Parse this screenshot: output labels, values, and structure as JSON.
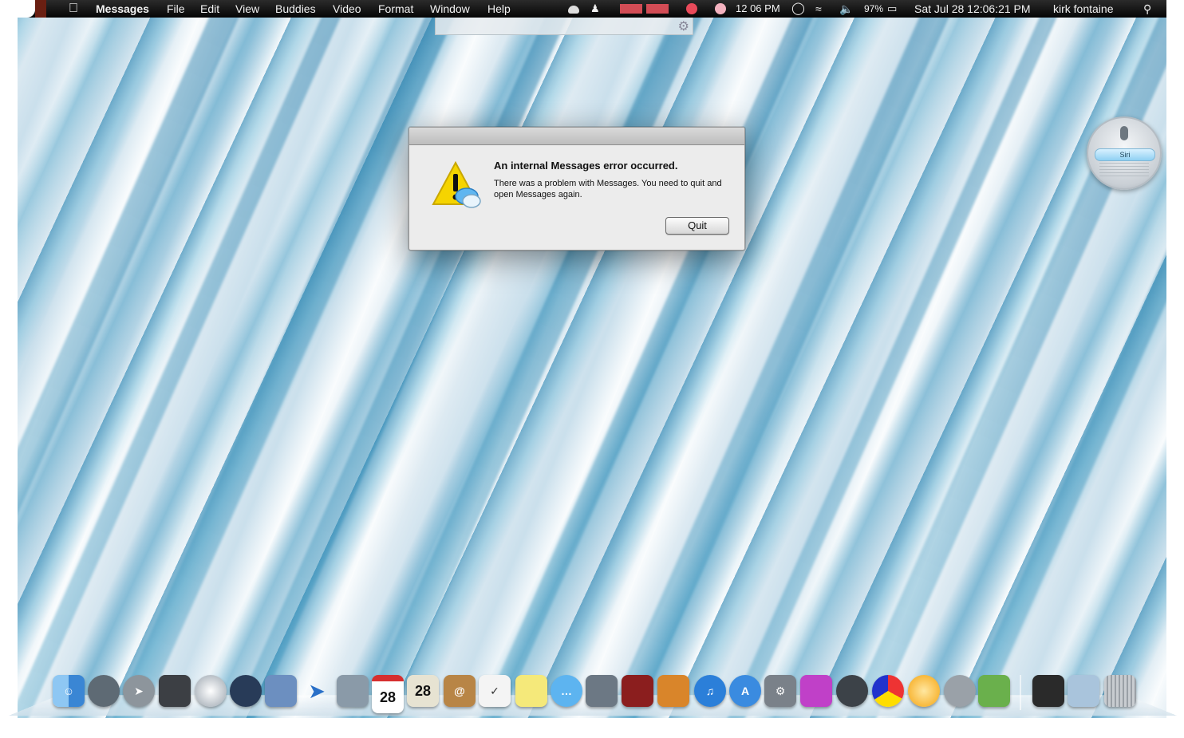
{
  "menubar": {
    "app_name": "Messages",
    "menus": [
      "File",
      "Edit",
      "View",
      "Buddies",
      "Video",
      "Format",
      "Window",
      "Help"
    ],
    "status_time": "12 06 PM",
    "battery": "97%",
    "clock": "Sat Jul 28  12:06:21 PM",
    "user": "kirk fontaine"
  },
  "dialog": {
    "headline": "An internal Messages error occurred.",
    "message": "There was a problem with Messages. You need to quit and open Messages again.",
    "quit_label": "Quit"
  },
  "siri": {
    "label": "Siri"
  },
  "dock": {
    "apps": [
      "finder",
      "launchpad-app",
      "rocket",
      "photo-app",
      "safari",
      "migration",
      "preview",
      "mail-send",
      "mail",
      "calendar",
      "ical",
      "contacts",
      "reminders",
      "notes",
      "messages",
      "facetime",
      "photo-booth",
      "iphoto",
      "itunes",
      "app-store",
      "system-preferences",
      "keynote",
      "time-machine",
      "colors",
      "orange-ball",
      "growl",
      "evernote",
      "folder-dark",
      "folder",
      "trash"
    ],
    "calendar_day": "28"
  },
  "colors": {
    "accent": "#2a7fb8",
    "menubar": "#0a0a0a",
    "dialog": "#ececec"
  }
}
